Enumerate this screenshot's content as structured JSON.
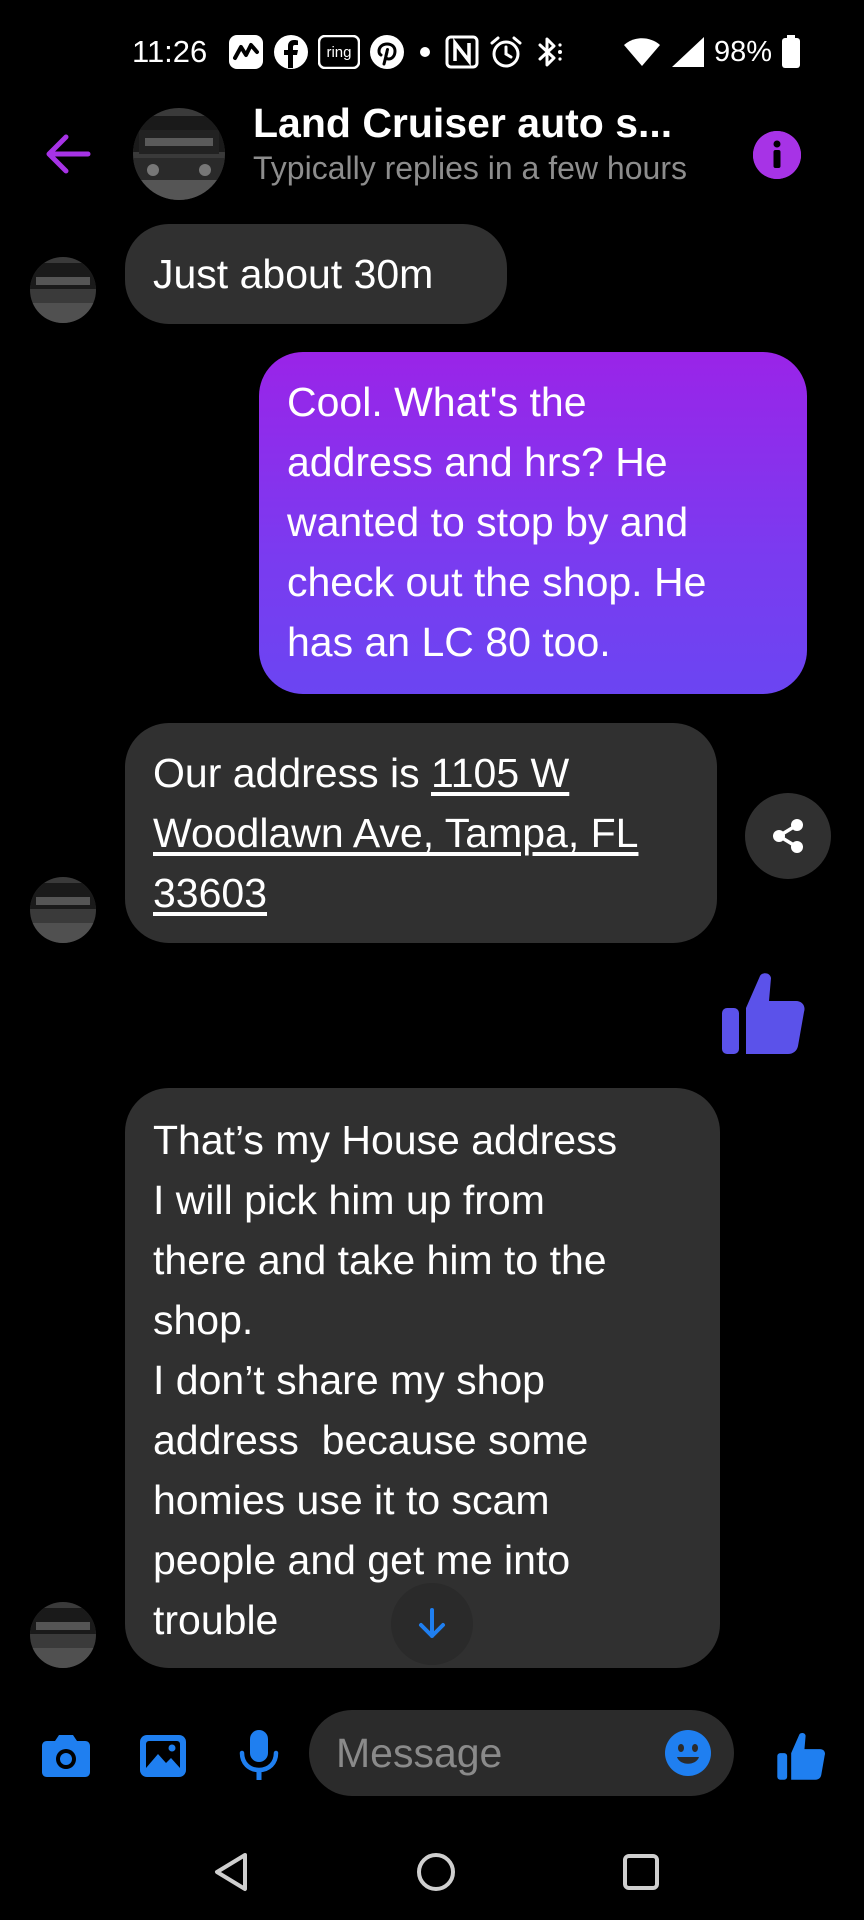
{
  "status_bar": {
    "time": "11:26",
    "battery": "98%",
    "icons": [
      "activity-icon",
      "facebook-icon",
      "ring-icon",
      "pinterest-icon",
      "dot-icon",
      "nfc-icon",
      "alarm-icon",
      "bluetooth-icon",
      "wifi-icon",
      "signal-icon",
      "battery-icon"
    ],
    "ring_label": "ring"
  },
  "header": {
    "title": "Land Cruiser auto s...",
    "subtitle": "Typically replies in a few hours"
  },
  "messages": [
    {
      "sender": "them",
      "text": "Just about 30m"
    },
    {
      "sender": "me",
      "lines": [
        "Cool. What's the",
        "address and hrs? He",
        "wanted to stop by and",
        "check out the shop. He",
        "has an LC 80 too."
      ]
    },
    {
      "sender": "them",
      "prefix": "Our address is ",
      "link_lines": [
        "1105 W",
        "Woodlawn Ave, Tampa, FL",
        "33603"
      ]
    },
    {
      "sender": "me",
      "type": "like"
    },
    {
      "sender": "them",
      "lines": [
        "That’s my House address",
        "I will pick him up from",
        "there and take him to the",
        "shop.",
        "I don’t share my shop",
        "address  because some",
        "homies use it to scam",
        "people and get me into",
        "trouble"
      ]
    }
  ],
  "composer": {
    "placeholder": "Message"
  },
  "colors": {
    "accent": "#a733e6",
    "blue": "#1f7ff0",
    "bubble_in": "#303030",
    "like_thumb": "#5b52ea"
  }
}
